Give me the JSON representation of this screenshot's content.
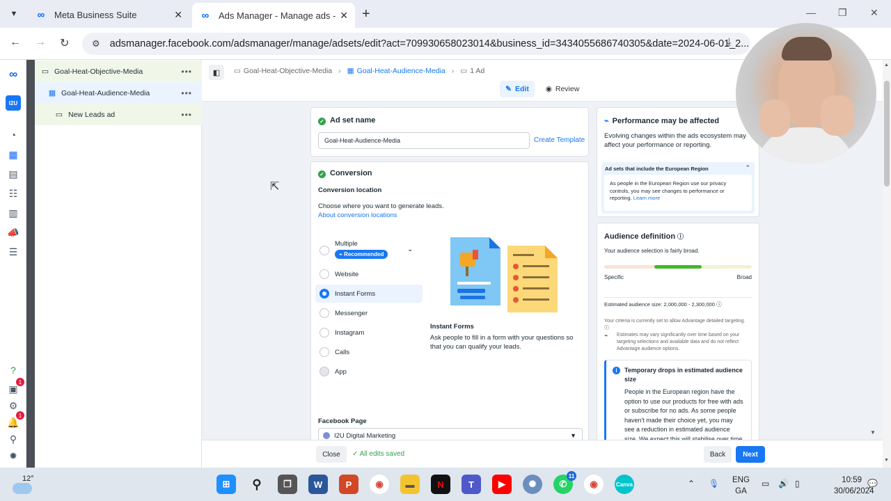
{
  "browser": {
    "tabs": [
      {
        "title": "Meta Business Suite",
        "active": false
      },
      {
        "title": "Ads Manager - Manage ads - A",
        "active": true
      }
    ],
    "url": "adsmanager.facebook.com/adsmanager/manage/adsets/edit?act=709930658023014&business_id=3434055686740305&date=2024-06-01_2..."
  },
  "rail": {
    "account_label": "I2U",
    "badge_counts": [
      "1",
      "1"
    ]
  },
  "tree": {
    "items": [
      {
        "label": "Goal-Heat-Objective-Media",
        "icon": "folder-icon"
      },
      {
        "label": "Goal-Heat-Audience-Media",
        "icon": "grid-icon"
      },
      {
        "label": "New Leads ad",
        "icon": "ad-icon"
      }
    ]
  },
  "header": {
    "breadcrumbs": [
      "Goal-Heat-Objective-Media",
      "Goal-Heat-Audience-Media",
      "1 Ad"
    ],
    "edit_label": "Edit",
    "review_label": "Review"
  },
  "adset_name": {
    "heading": "Ad set name",
    "value": "Goal-Heat-Audience-Media",
    "create_template": "Create Template"
  },
  "conversion": {
    "heading": "Conversion",
    "location_label": "Conversion location",
    "description": "Choose where you want to generate leads.",
    "about_link": "About conversion locations",
    "options": [
      {
        "label": "Multiple",
        "badge": "Recommended",
        "state": "normal"
      },
      {
        "label": "Website",
        "state": "normal"
      },
      {
        "label": "Instant Forms",
        "state": "selected"
      },
      {
        "label": "Messenger",
        "state": "normal"
      },
      {
        "label": "Instagram",
        "state": "normal"
      },
      {
        "label": "Calls",
        "state": "normal"
      },
      {
        "label": "App",
        "state": "disabled"
      }
    ],
    "selected_title": "Instant Forms",
    "selected_desc": "Ask people to fill in a form with your questions so that you can qualify your leads.",
    "facebook_page_label": "Facebook Page",
    "facebook_page_value": "I2U Digital Marketing"
  },
  "performance": {
    "title": "Performance may be affected",
    "body": "Evolving changes within the ads ecosystem may affect your performance or reporting.",
    "euro_title": "Ad sets that include the European Region",
    "euro_body": "As people in the European Region use our privacy controls, you may see changes to performance or reporting.",
    "learn_more": "Learn more"
  },
  "audience": {
    "title": "Audience definition",
    "status": "Your audience selection is fairly broad.",
    "specific": "Specific",
    "broad": "Broad",
    "meter_position": 0.5,
    "estimated_size": "Estimated audience size: 2,000,000 - 2,300,000",
    "criteria_note": "Your criteria is currently set to allow Advantage detailed targeting.",
    "estimate_note": "Estimates may vary significantly over time based on your targeting selections and available data and do not reflect Advantage audience options.",
    "drop_title": "Temporary drops in estimated audience size",
    "drop_body": "People in the European region have the option to use our products for free with ads or subscribe for no ads. As some people haven't made their choice yet, you may see a reduction in estimated audience size. We expect this will stabilise over time"
  },
  "footer": {
    "close": "Close",
    "saved": "All edits saved",
    "back": "Back",
    "next": "Next"
  },
  "taskbar": {
    "temperature": "12°",
    "language_top": "ENG",
    "language_bottom": "GA",
    "time": "10:59",
    "date": "30/06/2024",
    "chrome_badge": "11"
  },
  "colors": {
    "accent": "#1877f2",
    "success": "#31a24c",
    "meta_blue": "#0866ff"
  }
}
